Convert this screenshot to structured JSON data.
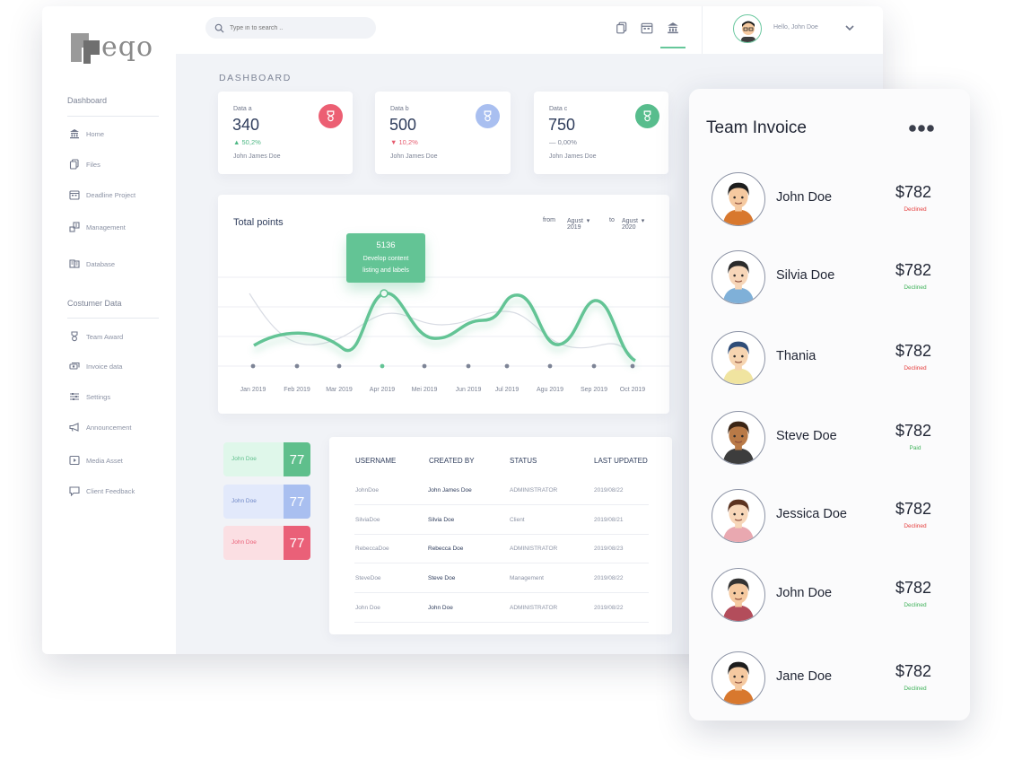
{
  "logo": {
    "text": "eqo"
  },
  "sidebar": {
    "section1": "Dashboard",
    "items1": [
      {
        "label": "Home",
        "icon": "bank-icon"
      },
      {
        "label": "Files",
        "icon": "files-icon"
      },
      {
        "label": "Deadline Project",
        "icon": "calendar-icon"
      },
      {
        "label": "Management",
        "icon": "management-icon"
      },
      {
        "label": "Database",
        "icon": "database-icon"
      }
    ],
    "section2": "Costumer Data",
    "items2": [
      {
        "label": "Team Award",
        "icon": "award-icon"
      },
      {
        "label": "Invoice data",
        "icon": "money-icon"
      },
      {
        "label": "Settings",
        "icon": "sliders-icon"
      },
      {
        "label": "Announcement",
        "icon": "megaphone-icon"
      },
      {
        "label": "Media Asset",
        "icon": "media-icon"
      },
      {
        "label": "Client Feedback",
        "icon": "chat-icon"
      }
    ]
  },
  "topbar": {
    "search_placeholder": "Type in to search ..",
    "greeting": "Hello, John Doe",
    "icons": [
      "files-icon",
      "calendar-icon",
      "bank-icon"
    ]
  },
  "dashboard": {
    "title": "DASHBOARD",
    "stats": [
      {
        "label": "Data a",
        "value": "340",
        "change": "50,2%",
        "direction": "up",
        "owner": "John James Doe",
        "badge_color": "#ec5f73"
      },
      {
        "label": "Data b",
        "value": "500",
        "change": "10,2%",
        "direction": "down",
        "owner": "John James Doe",
        "badge_color": "#a9bff0"
      },
      {
        "label": "Data c",
        "value": "750",
        "change": "0,00%",
        "direction": "flat",
        "owner": "John James Doe",
        "badge_color": "#58bd8d"
      }
    ]
  },
  "chart": {
    "title": "Total points",
    "from_label": "from",
    "from_month": "Agust",
    "from_year": "2019",
    "to_label": "to",
    "to_month": "Agust",
    "to_year": "2020",
    "tooltip_value": "5136",
    "tooltip_line1": "Develop content",
    "tooltip_line2": "listing and labels"
  },
  "chart_data": {
    "type": "line",
    "title": "Total points",
    "categories": [
      "Jan 2019",
      "Feb 2019",
      "Mar 2019",
      "Apr 2019",
      "Mei 2019",
      "Jun 2019",
      "Jul 2019",
      "Agu 2019",
      "Sep 2019",
      "Oct 2019"
    ],
    "annotations": [
      {
        "category": "Apr 2019",
        "value": 5136,
        "text": "Develop content listing and labels"
      }
    ]
  },
  "mini_cards": [
    {
      "name": "John Doe",
      "value": "77",
      "bg": "#dff7ea",
      "accent": "#5fbf8c",
      "text": "#5fbf8c"
    },
    {
      "name": "John Doe",
      "value": "77",
      "bg": "#e2e9fb",
      "accent": "#a9bff0",
      "text": "#6f87c6"
    },
    {
      "name": "John Doe",
      "value": "77",
      "bg": "#fbdfe3",
      "accent": "#ea6078",
      "text": "#ea6078"
    }
  ],
  "table": {
    "headers": [
      "USERNAME",
      "CREATED BY",
      "STATUS",
      "LAST UPDATED"
    ],
    "rows": [
      [
        "JohnDoe",
        "John James Doe",
        "ADMINISTRATOR",
        "2019/08/22"
      ],
      [
        "SilviaDoe",
        "Silvia Doe",
        "Client",
        "2019/08/21"
      ],
      [
        "RebeccaDoe",
        "Rebecca Doe",
        "ADMINISTRATOR",
        "2019/08/23"
      ],
      [
        "SteveDoe",
        "Steve Doe",
        "Management",
        "2019/08/22"
      ],
      [
        "John Doe",
        "John Doe",
        "ADMINISTRATOR",
        "2019/08/22"
      ]
    ]
  },
  "invoice": {
    "title": "Team Invoice",
    "colors": {
      "declined": "#e5403f",
      "paid": "#3fb25a"
    },
    "people": [
      {
        "name": "John Doe",
        "amount": "$782",
        "status": "Declined",
        "status_color": "#e5403f",
        "hair": "#1d1d1d",
        "shirt": "#d8782e",
        "skin": "#f5c9a0"
      },
      {
        "name": "Silvia Doe",
        "amount": "$782",
        "status": "Declined",
        "status_color": "#3fb25a",
        "hair": "#2b2b2b",
        "shirt": "#7fb0d8",
        "skin": "#f7d6b8"
      },
      {
        "name": "Thania",
        "amount": "$782",
        "status": "Declined",
        "status_color": "#e5403f",
        "hair": "#2f4d78",
        "shirt": "#f0e4a0",
        "skin": "#f6d4b0"
      },
      {
        "name": "Steve Doe",
        "amount": "$782",
        "status": "Paid",
        "status_color": "#3fb25a",
        "hair": "#3a2414",
        "shirt": "#3d3d3d",
        "skin": "#b97a47"
      },
      {
        "name": "Jessica Doe",
        "amount": "$782",
        "status": "Declined",
        "status_color": "#e5403f",
        "hair": "#5c3320",
        "shirt": "#e9a8b0",
        "skin": "#f7d6b8"
      },
      {
        "name": "John Doe",
        "amount": "$782",
        "status": "Declined",
        "status_color": "#3fb25a",
        "hair": "#333333",
        "shirt": "#b34d5b",
        "skin": "#f5c9a0"
      },
      {
        "name": "Jane Doe",
        "amount": "$782",
        "status": "Declined",
        "status_color": "#3fb25a",
        "hair": "#1d1d1d",
        "shirt": "#d8782e",
        "skin": "#f5c9a0"
      }
    ]
  }
}
